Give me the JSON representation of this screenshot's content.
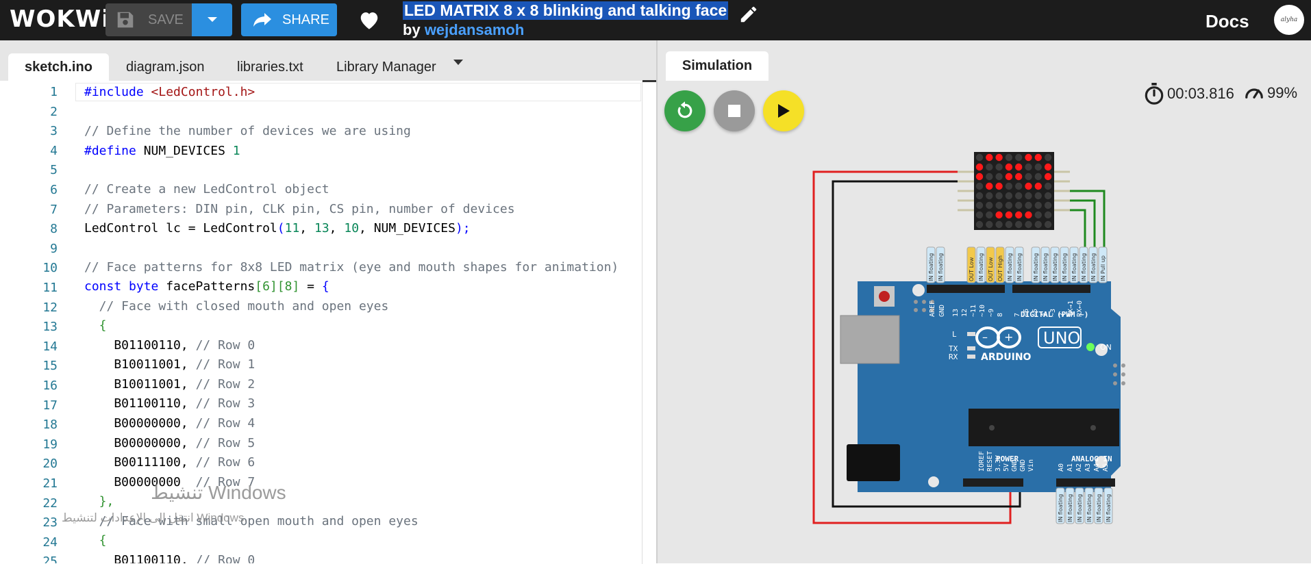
{
  "topbar": {
    "logo": "WOKWi",
    "save_label": "SAVE",
    "share_label": "SHARE",
    "project_title": "LED MATRIX 8 x 8 blinking and talking face",
    "by_prefix": "by",
    "author": "wejdansamoh",
    "docs_label": "Docs",
    "avatar_text": "alyha"
  },
  "editor": {
    "tabs": [
      "sketch.ino",
      "diagram.json",
      "libraries.txt",
      "Library Manager"
    ],
    "active_tab": "sketch.ino",
    "line_numbers": [
      "1",
      "2",
      "3",
      "4",
      "5",
      "6",
      "7",
      "8",
      "9",
      "10",
      "11",
      "12",
      "13",
      "14",
      "15",
      "16",
      "17",
      "18",
      "19",
      "20",
      "21",
      "22",
      "23",
      "24",
      "25"
    ]
  },
  "code": {
    "l1_include": "#include",
    "l1_header": "<LedControl.h>",
    "l3": "// Define the number of devices we are using",
    "l4_define": "#define",
    "l4_name": " NUM_DEVICES ",
    "l4_val": "1",
    "l6": "// Create a new LedControl object",
    "l7": "// Parameters: DIN pin, CLK pin, CS pin, number of devices",
    "l8_a": "LedControl lc = LedControl",
    "l8_paren": "(",
    "l8_n1": "11",
    "l8_c1": ", ",
    "l8_n2": "13",
    "l8_c2": ", ",
    "l8_n3": "10",
    "l8_rest": ", NUM_DEVICES",
    "l8_end": ");",
    "l10": "// Face patterns for 8x8 LED matrix (eye and mouth shapes for animation)",
    "l11_const": "const",
    "l11_byte": " byte",
    "l11_name": " facePatterns",
    "l11_d1": "[6]",
    "l11_d2": "[8]",
    "l11_eq": " = ",
    "l11_brace": "{",
    "l12": "  // Face with closed mouth and open eyes",
    "l13": "  {",
    "rows": [
      {
        "val": "    B01100110, ",
        "cmt": "// Row 0"
      },
      {
        "val": "    B10011001, ",
        "cmt": "// Row 1"
      },
      {
        "val": "    B10011001, ",
        "cmt": "// Row 2"
      },
      {
        "val": "    B01100110, ",
        "cmt": "// Row 3"
      },
      {
        "val": "    B00000000, ",
        "cmt": "// Row 4"
      },
      {
        "val": "    B00000000, ",
        "cmt": "// Row 5"
      },
      {
        "val": "    B00111100, ",
        "cmt": "// Row 6"
      },
      {
        "val": "    B00000000  ",
        "cmt": "// Row 7"
      }
    ],
    "l22": "  },",
    "l23": "  // Face with small open mouth and open eyes",
    "l24": "  {",
    "l25_val": "    B01100110, ",
    "l25_cmt": "// Row 0"
  },
  "watermark": {
    "line1": "تنشيط Windows",
    "line2": "انتقل إلى الإعدادات لتنشيط Windows."
  },
  "simulation": {
    "tab_label": "Simulation",
    "timer": "00:03.816",
    "speed": "99%",
    "board_brand": "ARDUINO",
    "board_model": "UNO",
    "digital_label": "DIGITAL (PWM ~)",
    "power_label": "POWER",
    "analog_label": "ANALOG IN",
    "on_label": "ON",
    "l_label": "L",
    "tx_label": "TX",
    "rx_label": "RX",
    "aref_label": "AREF",
    "gnd_label": "GND",
    "digital_pins": [
      "13",
      "12",
      "~11",
      "~10",
      "~9",
      "8",
      "7",
      "~6",
      "~5",
      "4",
      "~3",
      "2",
      "TX→1",
      "RX←0"
    ],
    "power_pins": [
      "IOREF",
      "RESET",
      "3.3V",
      "5V",
      "GND",
      "GND",
      "Vin"
    ],
    "analog_pins": [
      "A0",
      "A1",
      "A2",
      "A3",
      "A4",
      "A5"
    ],
    "pin_tag_in": "IN",
    "pin_tag_out": "OUT",
    "pin_state_floating": "floating",
    "pin_state_low": "Low",
    "pin_state_high": "High",
    "pin_state_pullup": "Pull up",
    "matrix_state": [
      "01100110",
      "10011001",
      "10011001",
      "01100110",
      "00000000",
      "00000000",
      "00111100",
      "00000000"
    ],
    "colors": {
      "led_on": "#ff1a1a",
      "led_off": "#3c3c3c",
      "board": "#2a6fa8",
      "wire_red": "#e02020",
      "wire_black": "#111111",
      "wire_green": "#1f8a1f",
      "run_button": "#f5e027",
      "restart_button": "#37a148",
      "stop_button": "#9a9a9a"
    }
  }
}
